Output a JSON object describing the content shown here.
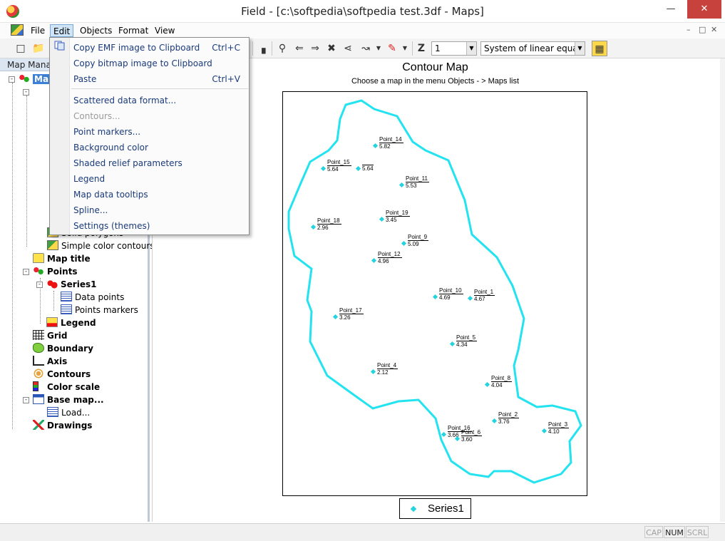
{
  "window": {
    "title": "Field - [c:\\softpedia\\softpedia test.3df - Maps]",
    "minimize": "—",
    "maximize": "□",
    "close": "✕"
  },
  "menubar": {
    "items": [
      "File",
      "Edit",
      "Objects",
      "Format",
      "View"
    ],
    "mdi": [
      "–",
      "□",
      "✕"
    ]
  },
  "toolbar": {
    "z_label": "Z",
    "z_value": "1",
    "equation_value": "System of linear equatio"
  },
  "left_panel": {
    "header": "Map Manag",
    "root": "Map",
    "tree": [
      {
        "label": "Solid polygons",
        "icon": "layer-icon"
      },
      {
        "label": "Simple color contours",
        "icon": "layer-icon"
      },
      {
        "label": "Map title",
        "icon": "title-icon",
        "bold": true
      },
      {
        "label": "Points",
        "icon": "points-icon",
        "bold": true
      },
      {
        "label": "Series1",
        "icon": "series-icon",
        "bold": true
      },
      {
        "label": "Data points",
        "icon": "table-icon"
      },
      {
        "label": "Points markers",
        "icon": "table-icon"
      },
      {
        "label": "Legend",
        "icon": "legend-icon",
        "bold": true
      },
      {
        "label": "Grid",
        "icon": "grid-icon",
        "bold": true
      },
      {
        "label": "Boundary",
        "icon": "boundary-icon",
        "bold": true
      },
      {
        "label": "Axis",
        "icon": "axis-icon",
        "bold": true
      },
      {
        "label": "Contours",
        "icon": "contours-icon",
        "bold": true
      },
      {
        "label": "Color scale",
        "icon": "color-scale-icon",
        "bold": true
      },
      {
        "label": "Base map...",
        "icon": "base-map-icon",
        "bold": true
      },
      {
        "label": "Load...",
        "icon": "table-icon"
      },
      {
        "label": "Drawings",
        "icon": "drawings-icon",
        "bold": true
      }
    ]
  },
  "edit_menu": {
    "items": [
      {
        "label": "Copy EMF image to Clipboard",
        "shortcut": "Ctrl+C",
        "enabled": true
      },
      {
        "label": "Copy bitmap image to Clipboard",
        "shortcut": "",
        "enabled": true
      },
      {
        "label": "Paste",
        "shortcut": "Ctrl+V",
        "enabled": true
      },
      {
        "label": "Scattered data format...",
        "shortcut": "",
        "enabled": true
      },
      {
        "label": "Contours...",
        "shortcut": "",
        "enabled": false
      },
      {
        "label": "Point markers...",
        "shortcut": "",
        "enabled": true
      },
      {
        "label": "Background color",
        "shortcut": "",
        "enabled": true
      },
      {
        "label": "Shaded relief parameters",
        "shortcut": "",
        "enabled": true
      },
      {
        "label": "Legend",
        "shortcut": "",
        "enabled": true
      },
      {
        "label": "Map data tooltips",
        "shortcut": "",
        "enabled": true
      },
      {
        "label": "Spline...",
        "shortcut": "",
        "enabled": true
      },
      {
        "label": "Settings (themes)",
        "shortcut": "",
        "enabled": true
      }
    ]
  },
  "map": {
    "title": "Contour Map",
    "subtitle": "Choose a map in the menu Objects - > Maps list",
    "boundary_color": "#22e3ef",
    "marker_color": "#22d3e0",
    "legend_label": "Series1",
    "points": [
      {
        "name": "Point_14",
        "value": "5.82"
      },
      {
        "name": "Point_15",
        "value": "5.64"
      },
      {
        "name": "",
        "value": "5.64"
      },
      {
        "name": "Point_11",
        "value": "5.53"
      },
      {
        "name": "Point_19",
        "value": "3.45"
      },
      {
        "name": "Point_18",
        "value": "2.96"
      },
      {
        "name": "Point_9",
        "value": "5.09"
      },
      {
        "name": "Point_12",
        "value": "4.96"
      },
      {
        "name": "Point_10",
        "value": "4.69"
      },
      {
        "name": "Point_1",
        "value": "4.67"
      },
      {
        "name": "Point_17",
        "value": "3.26"
      },
      {
        "name": "Point_5",
        "value": "4.34"
      },
      {
        "name": "Point_4",
        "value": "2.12"
      },
      {
        "name": "Point_8",
        "value": "4.04"
      },
      {
        "name": "Point_2",
        "value": "3.76"
      },
      {
        "name": "Point_3",
        "value": "4.10"
      },
      {
        "name": "Point_16",
        "value": "3.66"
      },
      {
        "name": "Point_6",
        "value": "3.60"
      }
    ]
  },
  "statusbar": {
    "cap": "CAP",
    "num": "NUM",
    "scrl": "SCRL"
  }
}
